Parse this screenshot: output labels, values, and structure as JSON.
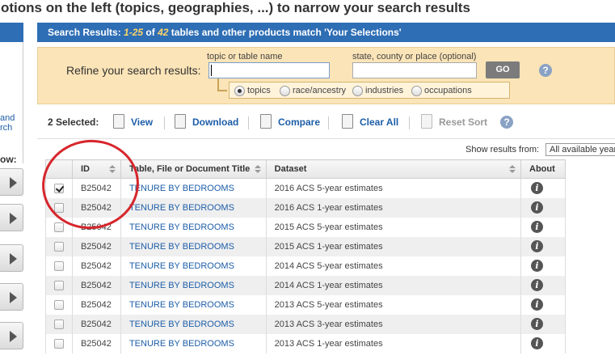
{
  "instructions": "otions on the left (topics, geographies, ...) to narrow your search results",
  "left_panel": {
    "link_lines": [
      "and",
      "rch"
    ],
    "show_label": "ow:"
  },
  "results_header": {
    "prefix": "Search Results: ",
    "range": "1-25",
    "of": " of ",
    "total": "42",
    "suffix": " tables and other products match 'Your Selections'"
  },
  "refine": {
    "label": "Refine your search results:",
    "topic_label": "topic or table name",
    "topic_value": "",
    "place_label": "state, county or place (optional)",
    "place_value": "",
    "go_label": "GO",
    "help_icon": "?",
    "radio_options": [
      {
        "label": "topics",
        "checked": true
      },
      {
        "label": "race/ancestry",
        "checked": false
      },
      {
        "label": "industries",
        "checked": false
      },
      {
        "label": "occupations",
        "checked": false
      }
    ]
  },
  "toolbar": {
    "selected": "2 Selected:",
    "view": "View",
    "download": "Download",
    "compare": "Compare",
    "clear_all": "Clear All",
    "reset_sort": "Reset Sort",
    "help_icon": "?"
  },
  "show_results": {
    "label": "Show results from:",
    "value": "All available years"
  },
  "table": {
    "columns": [
      "",
      "ID",
      "Table, File or Document Title",
      "Dataset",
      "About"
    ],
    "rows": [
      {
        "checked": true,
        "id": "B25042",
        "title": "TENURE BY BEDROOMS",
        "dataset": "2016 ACS 5-year estimates"
      },
      {
        "checked": false,
        "id": "B25042",
        "title": "TENURE BY BEDROOMS",
        "dataset": "2016 ACS 1-year estimates"
      },
      {
        "checked": false,
        "id": "B25042",
        "title": "TENURE BY BEDROOMS",
        "dataset": "2015 ACS 5-year estimates"
      },
      {
        "checked": false,
        "id": "B25042",
        "title": "TENURE BY BEDROOMS",
        "dataset": "2015 ACS 1-year estimates"
      },
      {
        "checked": false,
        "id": "B25042",
        "title": "TENURE BY BEDROOMS",
        "dataset": "2014 ACS 5-year estimates"
      },
      {
        "checked": false,
        "id": "B25042",
        "title": "TENURE BY BEDROOMS",
        "dataset": "2014 ACS 1-year estimates"
      },
      {
        "checked": false,
        "id": "B25042",
        "title": "TENURE BY BEDROOMS",
        "dataset": "2013 ACS 5-year estimates"
      },
      {
        "checked": false,
        "id": "B25042",
        "title": "TENURE BY BEDROOMS",
        "dataset": "2013 ACS 3-year estimates"
      },
      {
        "checked": false,
        "id": "B25042",
        "title": "TENURE BY BEDROOMS",
        "dataset": "2013 ACS 1-year estimates"
      }
    ],
    "info_glyph": "i"
  },
  "colors": {
    "header_blue": "#2e6eb5",
    "refine_bg": "#fbe4b7",
    "link_blue": "#1d5ea8",
    "highlight_red": "#d6262c"
  }
}
